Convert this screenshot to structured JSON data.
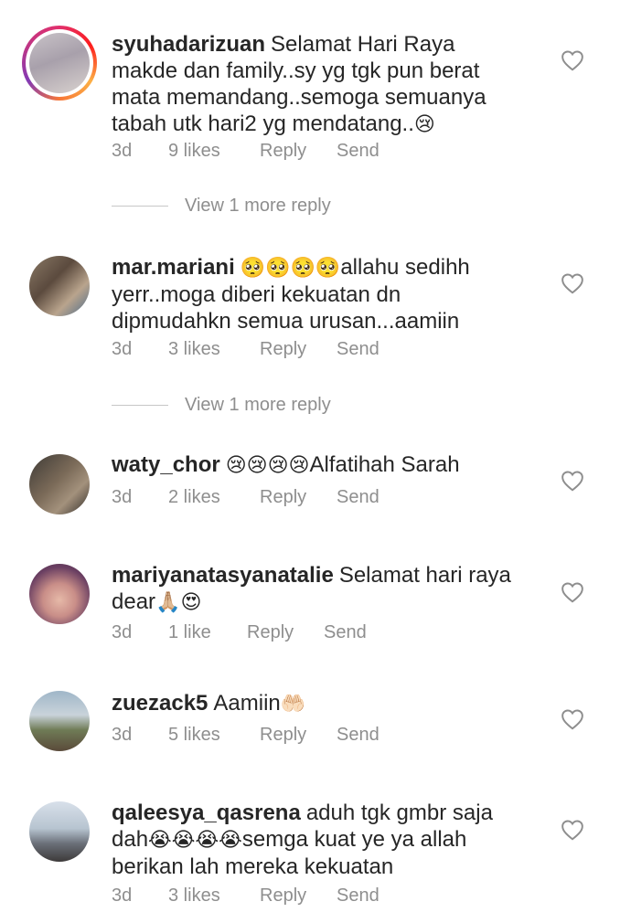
{
  "comments": [
    {
      "username": "syuhadarizuan",
      "text": "Selamat Hari Raya makde dan family..sy yg tgk pun berat mata memandang..semoga semuanya tabah utk hari2 yg mendatang..",
      "emoji": "😢",
      "time": "3d",
      "likes": "9 likes",
      "reply": "Reply",
      "send": "Send",
      "has_story": true
    },
    {
      "username": "mar.mariani",
      "emoji_prefix": "🥺🥺🥺🥺",
      "text": "allahu sedihh yerr..moga diberi kekuatan dn dipmudahkn semua urusan...aamiin",
      "time": "3d",
      "likes": "3 likes",
      "reply": "Reply",
      "send": "Send"
    },
    {
      "username": "waty_chor",
      "emoji_prefix": "😢😢😢😢",
      "text": "Alfatihah Sarah",
      "time": "3d",
      "likes": "2 likes",
      "reply": "Reply",
      "send": "Send"
    },
    {
      "username": "mariyanatasyanatalie",
      "text": "Selamat hari raya dear",
      "emoji": "🙏🏼😍",
      "time": "3d",
      "likes": "1 like",
      "reply": "Reply",
      "send": "Send"
    },
    {
      "username": "zuezack5",
      "text": "Aamiin",
      "emoji": "🤲🏻",
      "time": "3d",
      "likes": "5 likes",
      "reply": "Reply",
      "send": "Send"
    },
    {
      "username": "qaleesya_qasrena",
      "text": "aduh tgk gmbr saja dah",
      "emoji": "😭😭😭😭",
      "text_after": "semga kuat ye ya allah berikan lah mereka kekuatan",
      "time": "3d",
      "likes": "3 likes",
      "reply": "Reply",
      "send": "Send"
    }
  ],
  "view_more": [
    "View 1 more reply",
    "View 1 more reply"
  ],
  "colors": {
    "text": "#262626",
    "meta": "#8e8e8e",
    "story_ring": "#e1306c"
  },
  "icons": {
    "like": "heart-icon"
  }
}
